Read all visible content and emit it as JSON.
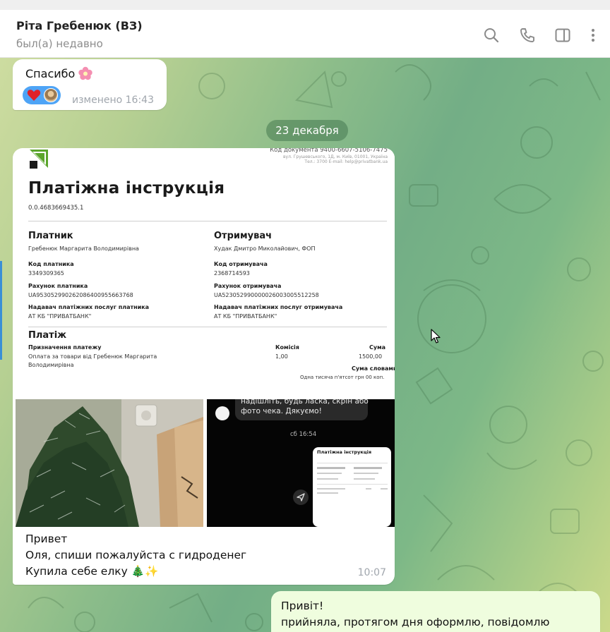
{
  "header": {
    "title": "Ріта Гребенюк (ВЗ)",
    "status": "был(а) недавно",
    "icons": [
      "search-icon",
      "phone-icon",
      "sidebar-toggle-icon",
      "more-vertical-icon"
    ]
  },
  "messages": {
    "m1": {
      "text": "Спасибо",
      "emoji": "flower",
      "reactions": [
        "heart",
        "avatar"
      ],
      "edited_time": "изменено 16:43"
    },
    "date_separator": "23 декабря",
    "m2": {
      "document": {
        "code": "Код документа 9400-6607-5106-7475",
        "address": "вул. Грушевського, 1Д, м. Київ, 01001, Україна",
        "contacts": "Тел.: 3700  E-mail: help@privatbank.ua",
        "title": "Платіжна інструкція",
        "number": "0.0.4683669435.1",
        "payer_heading": "Платник",
        "payer_name": "Гребенюк Маргарита Володимирівна",
        "payer_code_label": "Код платника",
        "payer_code": "3349309365",
        "payer_account_label": "Рахунок платника",
        "payer_account": "UA953052990262086400955663768",
        "payer_provider_label": "Надавач платіжних послуг платника",
        "payer_provider": "АТ КБ \"ПРИВАТБАНК\"",
        "receiver_heading": "Отримувач",
        "receiver_name": "Худак Дмитро Миколайович, ФОП",
        "receiver_code_label": "Код отримувача",
        "receiver_code": "2368714593",
        "receiver_account_label": "Рахунок отримувача",
        "receiver_account": "UA523052990000026003005512258",
        "receiver_provider_label": "Надавач платіжних послуг отримувача",
        "receiver_provider": "АТ КБ \"ПРИВАТБАНК\"",
        "payment_heading": "Платіж",
        "purpose_label": "Призначення платежу",
        "purpose_line1": "Оплата за товари від Гребенюк Маргарита",
        "purpose_line2": "Володимирівна",
        "fee_label": "Комісія",
        "fee": "1,00",
        "amount_label": "Сума",
        "amount": "1500,00",
        "amount_words_label": "Сума словами",
        "amount_words": "Одна тисяча п'ятсот грн 00 коп."
      },
      "screenshot": {
        "bubble_line1": "надішліть, будь ласка, скрін або",
        "bubble_line2": "фото чека. Дякуємо!",
        "time": "сб 16:54",
        "card_title": "Платіжна інструкція"
      },
      "caption_line1": "Привет",
      "caption_line2": "Оля, спиши пожалуйста с гидроденег",
      "caption_line3": "Купила себе елку 🎄✨",
      "time": "10:07"
    },
    "m3": {
      "line1": "Привіт!",
      "line2": "прийняла, протягом дня оформлю, повідомлю"
    }
  },
  "colors": {
    "accent": "#3a8fd6",
    "outgoing_bubble": "#effdde",
    "reaction_pill": "#4ea4f6",
    "privat_green": "#5ba52c"
  }
}
